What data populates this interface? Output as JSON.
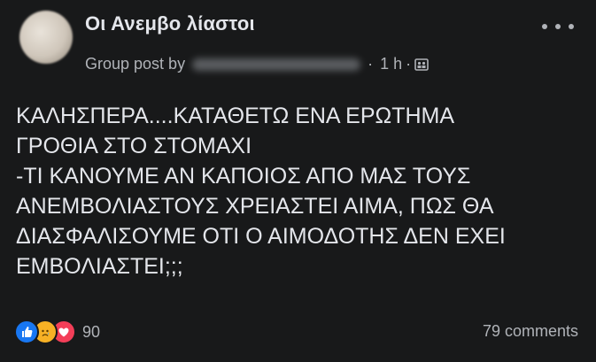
{
  "post": {
    "group_name": "Οι Ανεμβο λίαστοι",
    "meta_prefix": "Group post by",
    "time": "1 h",
    "separator": "·",
    "privacy_icon": "group-privacy-icon",
    "more_icon": "more-options-icon",
    "text_lines": [
      "ΚΑΛΗΣΠΕΡΑ....ΚΑΤΑΘΕΤΩ ΕΝΑ ΕΡΩΤΗΜΑ",
      "ΓΡΟΘΙΑ ΣΤΟ ΣΤΟΜΑΧΙ",
      "-ΤΙ ΚΑΝΟΥΜΕ ΑΝ ΚΑΠΟΙΟΣ ΑΠΟ ΜΑΣ ΤΟΥΣ",
      "ΑΝΕΜΒΟΛΙΑΣΤΟΥΣ ΧΡΕΙΑΣΤΕΙ ΑΙΜΑ, ΠΩΣ ΘΑ",
      "ΔΙΑΣΦΑΛΙΣΟΥΜΕ ΟΤΙ Ο ΑΙΜΟΔΟΤΗΣ ΔΕΝ ΕΧΕΙ",
      "ΕΜΒΟΛΙΑΣΤΕΙ;;;"
    ],
    "reactions": {
      "types": [
        "like-icon",
        "sad-icon",
        "love-icon"
      ],
      "count": "90"
    },
    "comments": "79 comments"
  },
  "colors": {
    "background": "#18191a",
    "primary_text": "#e4e6eb",
    "secondary_text": "#b0b3b8",
    "like": "#1877f2",
    "sad": "#f7b125",
    "love": "#f33e58"
  }
}
